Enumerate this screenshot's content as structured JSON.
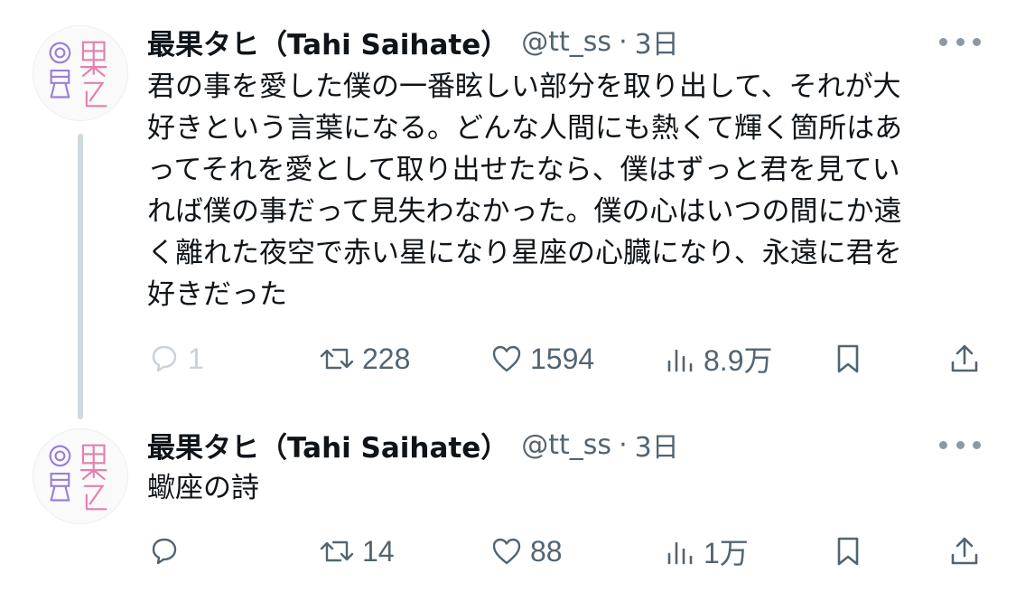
{
  "avatar": {
    "alt_glyphs": "最果タヒ",
    "accent_colors": [
      "#9a7fd8",
      "#e57fb0"
    ]
  },
  "tweets": [
    {
      "author": {
        "name": "最果タヒ（Tahi Saihate）",
        "handle": "@tt_ss"
      },
      "separator": "·",
      "time": "3日",
      "text": "君の事を愛した僕の一番眩しい部分を取り出して、それが大\n好きという言葉になる。どんな人間にも熱くて輝く箇所はあ\nってそれを愛として取り出せたなら、僕はずっと君を見てい\nれば僕の事だって見失わなかった。僕の心はいつの間にか遠\nく離れた夜空で赤い星になり星座の心臓になり、永遠に君を\n好きだった",
      "actions": {
        "replies": "1",
        "reposts": "228",
        "likes": "1594",
        "views": "8.9万"
      }
    },
    {
      "author": {
        "name": "最果タヒ（Tahi Saihate）",
        "handle": "@tt_ss"
      },
      "separator": "·",
      "time": "3日",
      "text": "蠍座の詩",
      "actions": {
        "replies": "",
        "reposts": "14",
        "likes": "88",
        "views": "1万"
      }
    }
  ],
  "icons": {
    "more": "more-dots-icon",
    "reply": "reply-bubble-icon",
    "repost": "repost-icon",
    "like": "heart-icon",
    "views": "views-bar-chart-icon",
    "bookmark": "bookmark-icon",
    "share": "share-icon"
  },
  "colors": {
    "text": "#0f1419",
    "secondary": "#536471",
    "thread_line": "#cfd9de"
  }
}
